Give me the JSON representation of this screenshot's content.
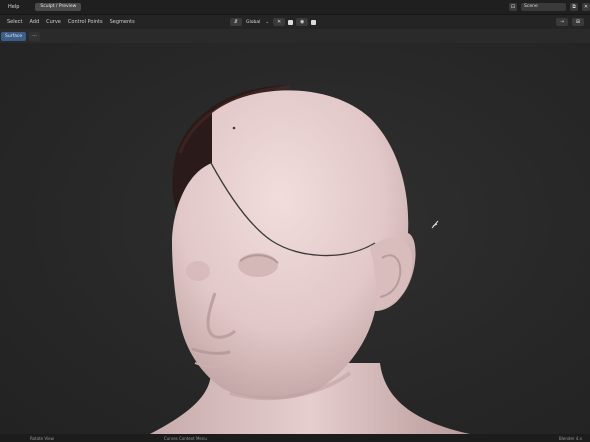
{
  "topbar": {
    "menu_help": "Help",
    "workspace_tab": "Sculpt / Preview",
    "scene_icon": "scene-icon",
    "scene_name": "Scene",
    "scene_copy": "⧉",
    "scene_close": "✕"
  },
  "header": {
    "menus": [
      "Select",
      "Add",
      "Curve",
      "Control Points",
      "Segments"
    ],
    "orientation": "Global",
    "orientation_chevron": "⌄",
    "snap_symbol": "✕",
    "proportional_symbol": "◉",
    "right_tool_1": "⇢",
    "right_tool_2": "⊞"
  },
  "mode": {
    "label": "Surface",
    "extra": "⋯"
  },
  "status": {
    "left": "Rotate View",
    "middle": "Curves Context Menu",
    "right": "Blender 4.x"
  },
  "colors": {
    "skin": "#e6cece",
    "skin_shadow": "#b89c9c",
    "hair": "#2a1b1a",
    "curve": "#3a3a3a",
    "accent": "#3d5d8a"
  }
}
